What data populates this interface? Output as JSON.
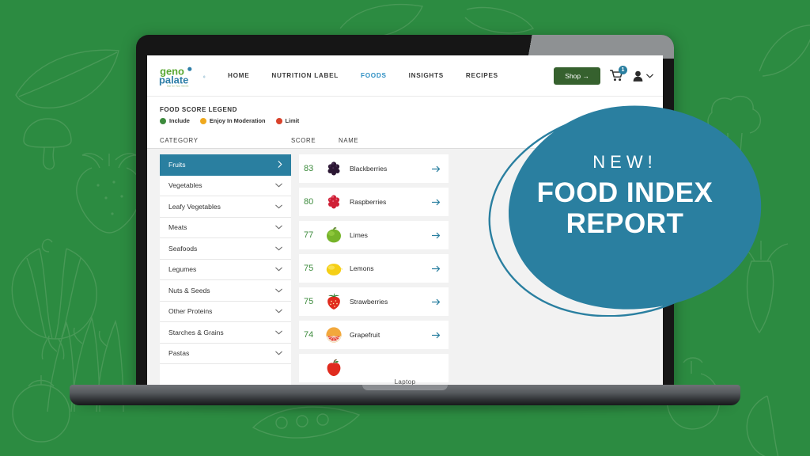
{
  "background": {
    "color": "#2c8b41",
    "pattern": "vegetable-line-art"
  },
  "device": {
    "label": "Laptop"
  },
  "app": {
    "logo": {
      "name": "genopalate-logo",
      "line1": "geno",
      "line2": "palate",
      "tagline": "Eat for Your Genes",
      "color_green": "#5aa832",
      "color_blue": "#2f7fa8"
    },
    "nav": {
      "links": [
        {
          "label": "HOME",
          "active": false
        },
        {
          "label": "NUTRITION LABEL",
          "active": false
        },
        {
          "label": "FOODS",
          "active": true
        },
        {
          "label": "INSIGHTS",
          "active": false
        },
        {
          "label": "RECIPES",
          "active": false
        }
      ],
      "active_color": "#2f90c4",
      "shop_button": {
        "label": "Shop →",
        "color": "#36612e"
      },
      "cart": {
        "icon": "shopping-cart-icon",
        "badge_count": "1",
        "badge_color": "#2a7fa0"
      },
      "account": {
        "icon": "user-avatar-icon",
        "chevron": "chevron-down-icon"
      }
    },
    "legend": {
      "title": "FOOD SCORE LEGEND",
      "items": [
        {
          "label": "Include",
          "color": "#3d8b3d"
        },
        {
          "label": "Enjoy In Moderation",
          "color": "#efa91e"
        },
        {
          "label": "Limit",
          "color": "#d9422b"
        }
      ]
    },
    "columns": {
      "category": "CATEGORY",
      "score": "SCORE",
      "name": "NAME"
    },
    "categories": {
      "selected_color": "#2a7fa0",
      "items": [
        {
          "label": "Fruits",
          "selected": true
        },
        {
          "label": "Vegetables",
          "selected": false
        },
        {
          "label": "Leafy Vegetables",
          "selected": false
        },
        {
          "label": "Meats",
          "selected": false
        },
        {
          "label": "Seafoods",
          "selected": false
        },
        {
          "label": "Legumes",
          "selected": false
        },
        {
          "label": "Nuts & Seeds",
          "selected": false
        },
        {
          "label": "Other Proteins",
          "selected": false
        },
        {
          "label": "Starches & Grains",
          "selected": false
        },
        {
          "label": "Pastas",
          "selected": false
        }
      ]
    },
    "foods": {
      "score_color": "#3d8b3d",
      "arrow_color": "#2a7fa0",
      "items": [
        {
          "score": "83",
          "name": "Blackberries",
          "thumb": "blackberries"
        },
        {
          "score": "80",
          "name": "Raspberries",
          "thumb": "raspberries"
        },
        {
          "score": "77",
          "name": "Limes",
          "thumb": "limes"
        },
        {
          "score": "75",
          "name": "Lemons",
          "thumb": "lemons"
        },
        {
          "score": "75",
          "name": "Strawberries",
          "thumb": "strawberries"
        },
        {
          "score": "74",
          "name": "Grapefruit",
          "thumb": "grapefruit"
        },
        {
          "score": "",
          "name": "",
          "thumb": "apple"
        }
      ]
    }
  },
  "badge": {
    "new": "NEW!",
    "line1": "FOOD INDEX",
    "line2": "REPORT",
    "fill_color": "#2a7fa0",
    "ring_color": "#2a7fa0"
  }
}
